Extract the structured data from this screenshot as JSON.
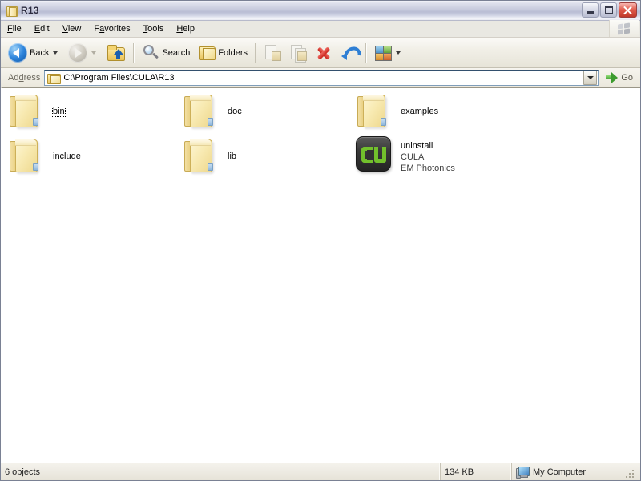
{
  "window": {
    "title": "R13",
    "title_icon": "folder-icon",
    "controls": {
      "minimize": "minimize-button",
      "maximize": "maximize-button",
      "close": "close-button"
    }
  },
  "menubar": {
    "items": [
      {
        "label": "File",
        "accel": "F"
      },
      {
        "label": "Edit",
        "accel": "E"
      },
      {
        "label": "View",
        "accel": "V"
      },
      {
        "label": "Favorites",
        "accel": "a"
      },
      {
        "label": "Tools",
        "accel": "T"
      },
      {
        "label": "Help",
        "accel": "H"
      }
    ],
    "branding_icon": "windows-flag-icon"
  },
  "toolbar": {
    "back_label": "Back",
    "search_label": "Search",
    "folders_label": "Folders",
    "buttons": [
      {
        "name": "back-button",
        "icon": "arrow-left-icon",
        "enabled": true
      },
      {
        "name": "forward-button",
        "icon": "arrow-right-icon",
        "enabled": false
      },
      {
        "name": "up-button",
        "icon": "folder-up-icon",
        "enabled": true
      },
      {
        "name": "search-button",
        "icon": "magnifier-icon",
        "enabled": true
      },
      {
        "name": "folders-button",
        "icon": "folder-icon",
        "enabled": true
      },
      {
        "name": "move-to-button",
        "icon": "move-to-folder-icon",
        "enabled": false
      },
      {
        "name": "copy-to-button",
        "icon": "copy-to-folder-icon",
        "enabled": false
      },
      {
        "name": "delete-button",
        "icon": "delete-x-icon",
        "enabled": true
      },
      {
        "name": "undo-button",
        "icon": "undo-arrow-icon",
        "enabled": true
      },
      {
        "name": "views-button",
        "icon": "views-tiles-icon",
        "enabled": true
      }
    ]
  },
  "address": {
    "label": "Address",
    "label_accel": "d",
    "path": "C:\\Program Files\\CULA\\R13",
    "folder_icon": "folder-icon",
    "dropdown_icon": "chevron-down-icon",
    "go_label": "Go",
    "go_icon": "green-arrow-icon"
  },
  "items": [
    {
      "name": "bin",
      "icon": "folder-icon",
      "focused": true,
      "subtitles": []
    },
    {
      "name": "doc",
      "icon": "folder-icon",
      "focused": false,
      "subtitles": []
    },
    {
      "name": "examples",
      "icon": "folder-icon",
      "focused": false,
      "subtitles": []
    },
    {
      "name": "include",
      "icon": "folder-icon",
      "focused": false,
      "subtitles": []
    },
    {
      "name": "lib",
      "icon": "folder-icon",
      "focused": false,
      "subtitles": []
    },
    {
      "name": "uninstall",
      "icon": "cula-app-icon",
      "focused": false,
      "subtitles": [
        "CULA",
        "EM Photonics"
      ]
    }
  ],
  "item_labels": {
    "i0_name": "bin",
    "i1_name": "doc",
    "i2_name": "examples",
    "i3_name": "include",
    "i4_name": "lib",
    "i5_name": "uninstall",
    "i5_sub1": "CULA",
    "i5_sub2": "EM Photonics"
  },
  "statusbar": {
    "objects": "6 objects",
    "size": "134 KB",
    "location": "My Computer",
    "location_icon": "my-computer-icon"
  },
  "colors": {
    "title_gradient_top": "#f2f3f9",
    "title_gradient_mid": "#b9bdd4",
    "close_button": "#c0392b",
    "folder_yellow": "#f8eab2",
    "cula_green": "#72c02c",
    "cula_dark": "#3a3a3a",
    "content_bg": "#ffffff",
    "chrome_bg": "#ece9d8"
  }
}
